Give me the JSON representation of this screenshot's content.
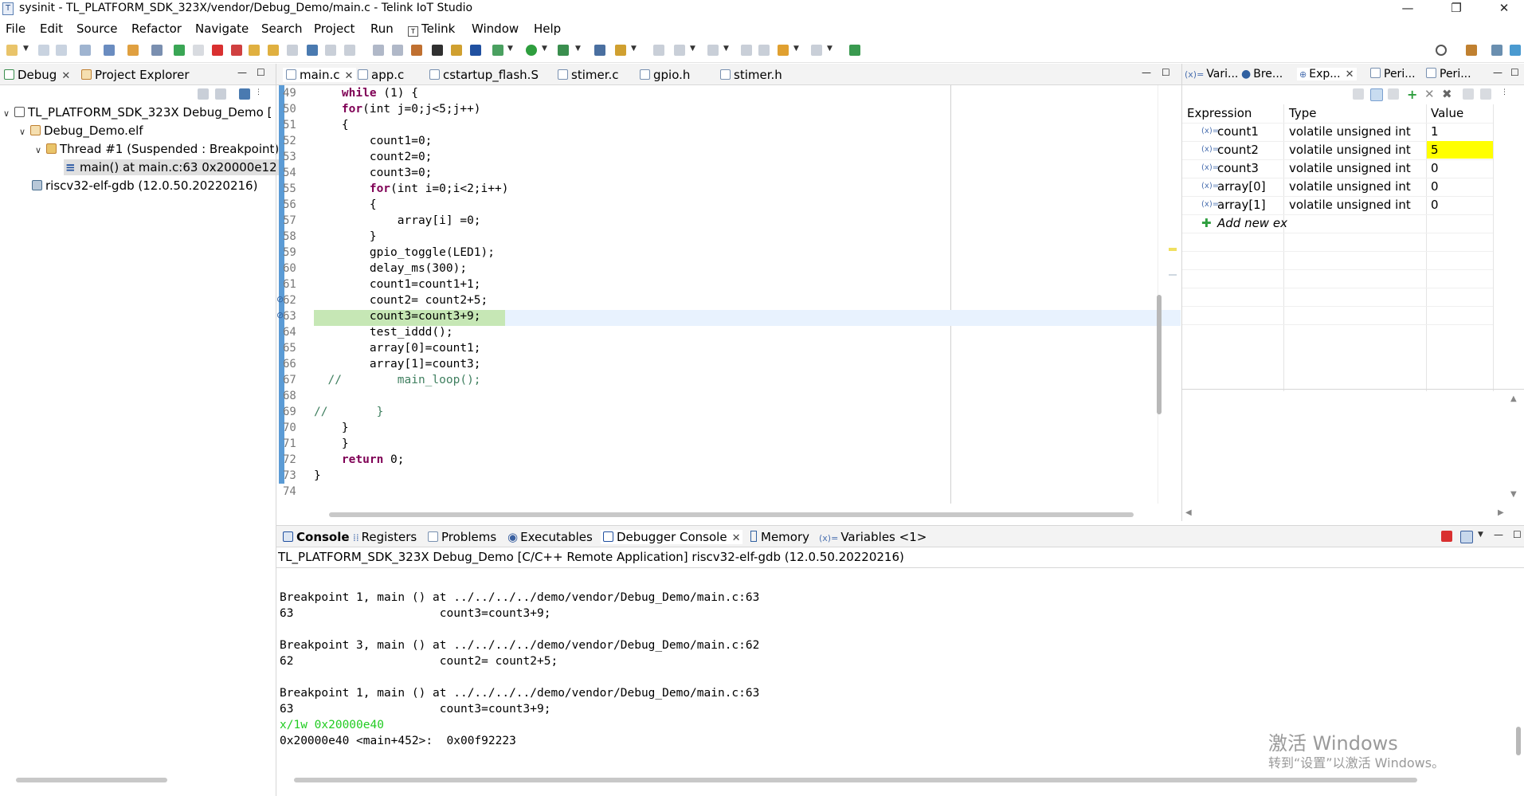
{
  "window": {
    "title": "sysinit - TL_PLATFORM_SDK_323X/vendor/Debug_Demo/main.c - Telink IoT Studio",
    "controls": [
      "—",
      "❐",
      "✕"
    ]
  },
  "menu": [
    "File",
    "Edit",
    "Source",
    "Refactor",
    "Navigate",
    "Search",
    "Project",
    "Run",
    "Telink",
    "Window",
    "Help"
  ],
  "debug_panel": {
    "tabs": [
      {
        "label": "Debug"
      },
      {
        "label": "Project Explorer"
      }
    ],
    "tree": [
      {
        "label": "TL_PLATFORM_SDK_323X Debug_Demo ["
      },
      {
        "label": "Debug_Demo.elf"
      },
      {
        "label": "Thread #1 (Suspended : Breakpoint)"
      },
      {
        "label": "main() at main.c:63 0x20000e12"
      },
      {
        "label": "riscv32-elf-gdb (12.0.50.20220216)"
      }
    ]
  },
  "editor": {
    "tabs": [
      "main.c",
      "app.c",
      "cstartup_flash.S",
      "stimer.c",
      "gpio.h",
      "stimer.h"
    ],
    "current_line": 63,
    "lines": [
      {
        "n": "49",
        "indent": "    ",
        "kw": "while",
        "rest": " (1) {"
      },
      {
        "n": "50",
        "indent": "    ",
        "kw": "for",
        "rest": "(int j=0;j<5;j++)"
      },
      {
        "n": "51",
        "indent": "    ",
        "kw": "",
        "rest": "{"
      },
      {
        "n": "52",
        "indent": "        ",
        "kw": "",
        "rest": "count1=0;"
      },
      {
        "n": "53",
        "indent": "        ",
        "kw": "",
        "rest": "count2=0;"
      },
      {
        "n": "54",
        "indent": "        ",
        "kw": "",
        "rest": "count3=0;"
      },
      {
        "n": "55",
        "indent": "        ",
        "kw": "for",
        "rest": "(int i=0;i<2;i++)"
      },
      {
        "n": "56",
        "indent": "        ",
        "kw": "",
        "rest": "{"
      },
      {
        "n": "57",
        "indent": "            ",
        "kw": "",
        "rest": "array[i] =0;"
      },
      {
        "n": "58",
        "indent": "        ",
        "kw": "",
        "rest": "}"
      },
      {
        "n": "59",
        "indent": "        ",
        "kw": "",
        "rest": "gpio_toggle(LED1);"
      },
      {
        "n": "60",
        "indent": "        ",
        "kw": "",
        "rest": "delay_ms(300);"
      },
      {
        "n": "61",
        "indent": "        ",
        "kw": "",
        "rest": "count1=count1+1;"
      },
      {
        "n": "62",
        "indent": "        ",
        "kw": "",
        "rest": "count2= count2+5;"
      },
      {
        "n": "63",
        "indent": "        ",
        "kw": "",
        "rest": "count3=count3+9;"
      },
      {
        "n": "64",
        "indent": "        ",
        "kw": "",
        "rest": "test_iddd();"
      },
      {
        "n": "65",
        "indent": "        ",
        "kw": "",
        "rest": "array[0]=count1;"
      },
      {
        "n": "66",
        "indent": "        ",
        "kw": "",
        "rest": "array[1]=count3;"
      },
      {
        "n": "67",
        "indent": "  ",
        "kw": "",
        "rest": "//        main_loop();",
        "comment": true
      },
      {
        "n": "68",
        "indent": "",
        "kw": "",
        "rest": ""
      },
      {
        "n": "69",
        "indent": "",
        "kw": "",
        "rest": "//       }",
        "comment": true
      },
      {
        "n": "70",
        "indent": "    ",
        "kw": "",
        "rest": "}"
      },
      {
        "n": "71",
        "indent": "    ",
        "kw": "",
        "rest": "}"
      },
      {
        "n": "72",
        "indent": "    ",
        "kw": "return",
        "rest": " 0;"
      },
      {
        "n": "73",
        "indent": "",
        "kw": "",
        "rest": "}"
      },
      {
        "n": "74",
        "indent": "",
        "kw": "",
        "rest": ""
      }
    ]
  },
  "expressions": {
    "tabs": [
      "Vari...",
      "Bre...",
      "Exp...",
      "Peri...",
      "Peri..."
    ],
    "columns": [
      "Expression",
      "Type",
      "Value"
    ],
    "rows": [
      {
        "expr": "count1",
        "type": "volatile unsigned int",
        "value": "1",
        "changed": false
      },
      {
        "expr": "count2",
        "type": "volatile unsigned int",
        "value": "5",
        "changed": true
      },
      {
        "expr": "count3",
        "type": "volatile unsigned int",
        "value": "0",
        "changed": false
      },
      {
        "expr": "array[0]",
        "type": "volatile unsigned int",
        "value": "0",
        "changed": false
      },
      {
        "expr": "array[1]",
        "type": "volatile unsigned int",
        "value": "0",
        "changed": false
      }
    ],
    "add_new": "Add new ex",
    "highlight_color": "#ffff00"
  },
  "console": {
    "tabs": [
      "Console",
      "Registers",
      "Problems",
      "Executables",
      "Debugger Console",
      "Memory",
      "Variables <1>"
    ],
    "header": "TL_PLATFORM_SDK_323X Debug_Demo [C/C++ Remote Application] riscv32-elf-gdb (12.0.50.20220216)",
    "lines": [
      {
        "text": "",
        "color": "#000000"
      },
      {
        "text": "Breakpoint 1, main () at ../../../../demo/vendor/Debug_Demo/main.c:63",
        "color": "#000000"
      },
      {
        "text": "63                     count3=count3+9;",
        "color": "#000000"
      },
      {
        "text": "",
        "color": "#000000"
      },
      {
        "text": "Breakpoint 3, main () at ../../../../demo/vendor/Debug_Demo/main.c:62",
        "color": "#000000"
      },
      {
        "text": "62                     count2= count2+5;",
        "color": "#000000"
      },
      {
        "text": "",
        "color": "#000000"
      },
      {
        "text": "Breakpoint 1, main () at ../../../../demo/vendor/Debug_Demo/main.c:63",
        "color": "#000000"
      },
      {
        "text": "63                     count3=count3+9;",
        "color": "#000000"
      },
      {
        "text": "x/1w 0x20000e40",
        "color": "#22cc22"
      },
      {
        "text": "0x20000e40 <main+452>:  0x00f92223",
        "color": "#000000"
      }
    ]
  },
  "watermark": {
    "line1": "激活 Windows",
    "line2": "转到“设置”以激活 Windows。"
  }
}
